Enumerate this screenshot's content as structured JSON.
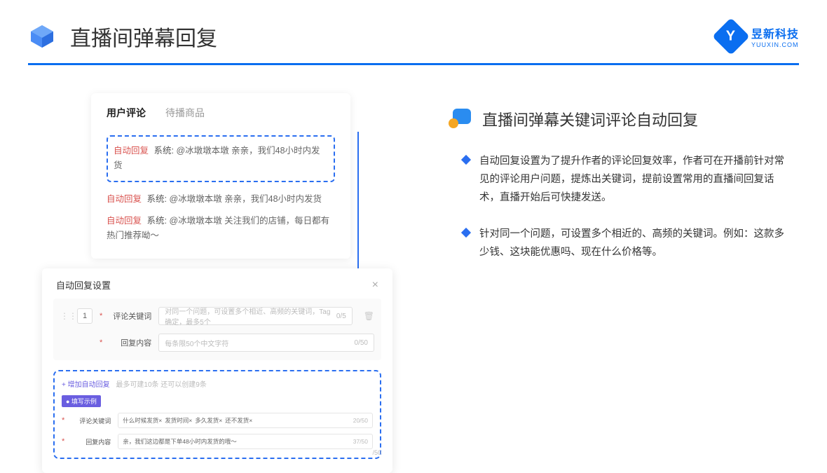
{
  "header": {
    "title": "直播间弹幕回复",
    "logo_cn": "昱新科技",
    "logo_en": "YUUXIN.COM"
  },
  "comments_card": {
    "tabs": {
      "active": "用户评论",
      "inactive": "待播商品"
    },
    "highlight": {
      "badge": "自动回复",
      "sys": "系统:",
      "text": "@冰墩墩本墩 亲亲，我们48小时内发货"
    },
    "rows": [
      {
        "badge": "自动回复",
        "sys": "系统:",
        "text": "@冰墩墩本墩 亲亲，我们48小时内发货"
      },
      {
        "badge": "自动回复",
        "sys": "系统:",
        "text": "@冰墩墩本墩 关注我们的店铺，每日都有热门推荐呦～"
      }
    ]
  },
  "settings": {
    "title": "自动回复设置",
    "num": "1",
    "field1_label": "评论关键词",
    "field1_placeholder": "对同一个问题，可设置多个相近、高频的关键词，Tag确定，最多5个",
    "field1_count": "0/5",
    "field2_label": "回复内容",
    "field2_placeholder": "每条限50个中文字符",
    "field2_count": "0/50",
    "add_link": "+ 增加自动回复",
    "add_hint": "最多可建10条 还可以创建9条",
    "example_tag": "● 填写示例",
    "ex_field1_label": "评论关键词",
    "ex_keywords": [
      "什么时候发货×",
      "发货时间×",
      "多久发货×",
      "还不发货×"
    ],
    "ex_field1_count": "20/50",
    "ex_field2_label": "回复内容",
    "ex_reply": "亲，我们这边都是下单48小时内发货的哦～",
    "ex_field2_count": "37/50",
    "hanging_count": "/50"
  },
  "right": {
    "title": "直播间弹幕关键词评论自动回复",
    "bullets": [
      "自动回复设置为了提升作者的评论回复效率，作者可在开播前针对常见的评论用户问题，提炼出关键词，提前设置常用的直播间回复话术，直播开始后可快捷发送。",
      "针对同一个问题，可设置多个相近的、高频的关键词。例如：这款多少钱、这块能优惠吗、现在什么价格等。"
    ]
  }
}
